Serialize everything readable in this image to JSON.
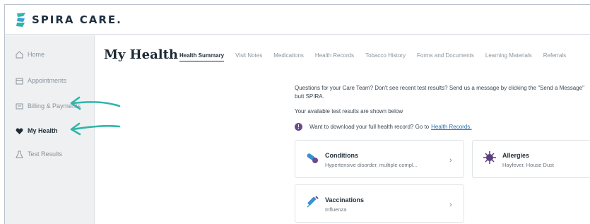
{
  "app": {
    "name": "SPIRA CARE."
  },
  "sidebar": {
    "items": [
      {
        "label": "Home",
        "icon": "home-icon"
      },
      {
        "label": "Appointments",
        "icon": "calendar-icon"
      },
      {
        "label": "Billing & Payments",
        "icon": "billing-icon"
      },
      {
        "label": "My Health",
        "icon": "heart-icon",
        "active": true
      },
      {
        "label": "Test Results",
        "icon": "flask-icon"
      }
    ]
  },
  "main": {
    "title": "My Health",
    "tabs": [
      {
        "label": "Health Summary",
        "active": true
      },
      {
        "label": "Visit Notes"
      },
      {
        "label": "Medications"
      },
      {
        "label": "Health Records"
      },
      {
        "label": "Tobacco History"
      },
      {
        "label": "Forms and Documents"
      },
      {
        "label": "Learning Materials"
      },
      {
        "label": "Referrals"
      }
    ],
    "message": "Questions for your Care Team? Don't see recent test results? Send us a message by clicking the \"Send a Message\" butt SPIRA.",
    "message2": "Your available test results are shown below",
    "banner": {
      "text": "Want to download your full health record? Go to",
      "link": "Health Records."
    },
    "cards": [
      {
        "title": "Conditions",
        "subtitle": "Hypertensive disorder, multiple compl...",
        "icon": "pills-icon"
      },
      {
        "title": "Allergies",
        "subtitle": "Hayfever, House Dust",
        "icon": "virus-icon"
      },
      {
        "title": "Vaccinations",
        "subtitle": "Influenza",
        "icon": "syringe-icon"
      }
    ]
  },
  "colors": {
    "accent": "#2fb5a8",
    "brand_dark": "#1f3140",
    "sidebar_bg": "#eef0f2",
    "link": "#2f6fa8",
    "info": "#6b4a8e"
  }
}
